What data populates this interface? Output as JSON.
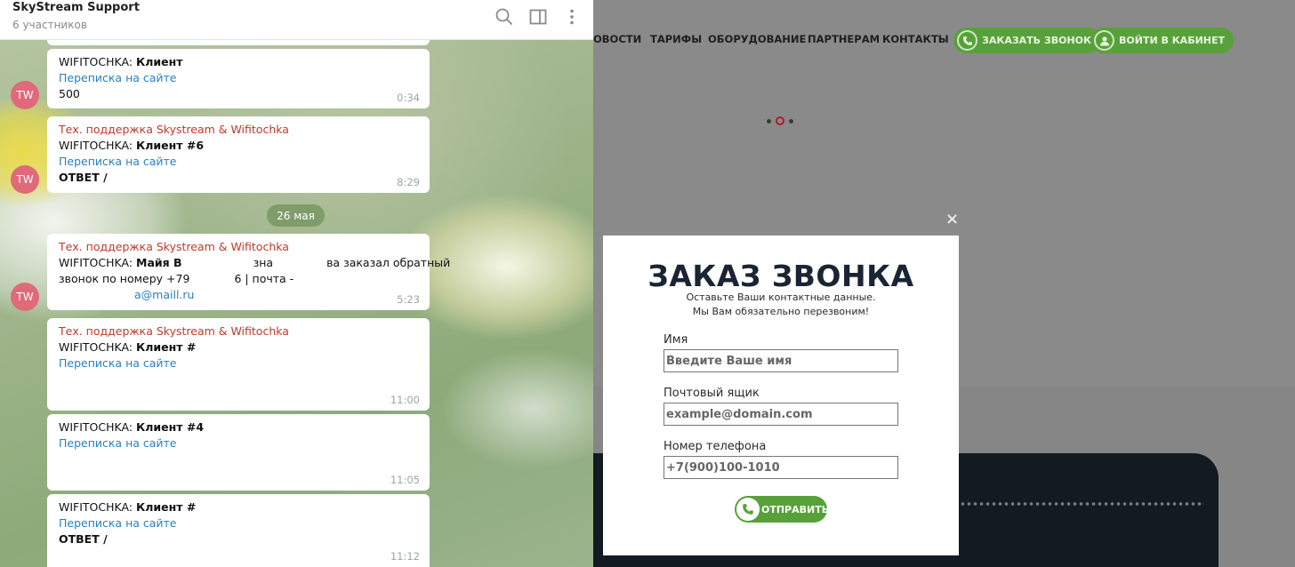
{
  "telegram": {
    "title": "SkyStream Support",
    "subtitle": "6 участников",
    "icons": [
      "search-icon",
      "sidebar-toggle-icon",
      "more-vertical-icon"
    ],
    "date_separator": "26 мая",
    "avatar_initials": "TW",
    "messages": [
      {
        "line1_prefix": "WIFITOCHKA: ",
        "line1_bold": "Клиент",
        "link": "Переписка на сайте",
        "body": "500",
        "time": "0:34"
      },
      {
        "sender": "Тех. поддержка Skystream & Wifitochka",
        "line1_prefix": "WIFITOCHKA: ",
        "line1_bold": "Клиент #6",
        "link": "Переписка на сайте",
        "body_bold": "ОТВЕТ /",
        "time": "8:29"
      },
      {
        "sender": "Тех. поддержка Skystream & Wifitochka",
        "line1_prefix": "WIFITOCHKA: ",
        "line1_bold": "Майя В",
        "line1_mid": "зна",
        "line1_tail": "ва заказал обратный",
        "line2": "звонок по номеру +79",
        "line2_tail": "6 | почта -",
        "email_tail": "а@maill.ru",
        "time": "5:23"
      },
      {
        "sender": "Тех. поддержка Skystream & Wifitochka",
        "line1_prefix": "WIFITOCHKA: ",
        "line1_bold": "Клиент #",
        "link": "Переписка на сайте",
        "time": "11:00"
      },
      {
        "line1_prefix": "WIFITOCHKA: ",
        "line1_bold": "Клиент #4",
        "link": "Переписка на сайте",
        "time": "11:05"
      },
      {
        "line1_prefix": "WIFITOCHKA: ",
        "line1_bold": "Клиент #",
        "link": "Переписка на сайте",
        "body_bold": "ОТВЕТ /",
        "time": "11:12"
      }
    ]
  },
  "site": {
    "nav": [
      "ОВОСТИ",
      "ТАРИФЫ",
      "ОБОРУДОВАНИЕ",
      "ПАРТНЕРАМ",
      "КОНТАКТЫ"
    ],
    "call_button": "ЗАКАЗАТЬ ЗВОНОК",
    "login_button": "ВОЙТИ В КАБИНЕТ",
    "close_symbol": "×",
    "modal": {
      "title": "ЗАКАЗ ЗВОНКА",
      "subtitle_1": "Оставьте Ваши контактные данные.",
      "subtitle_2": "Мы Вам обязательно перезвоним!",
      "name_label": "Имя",
      "name_placeholder": "Введите Ваше имя",
      "email_label": "Почтовый ящик",
      "email_placeholder": "example@domain.com",
      "phone_label": "Номер телефона",
      "phone_placeholder": "+7(900)100-1010",
      "submit": "ОТПРАВИТЬ"
    },
    "accent_color": "#58a13a",
    "slider_active_color": "#b5192c"
  }
}
